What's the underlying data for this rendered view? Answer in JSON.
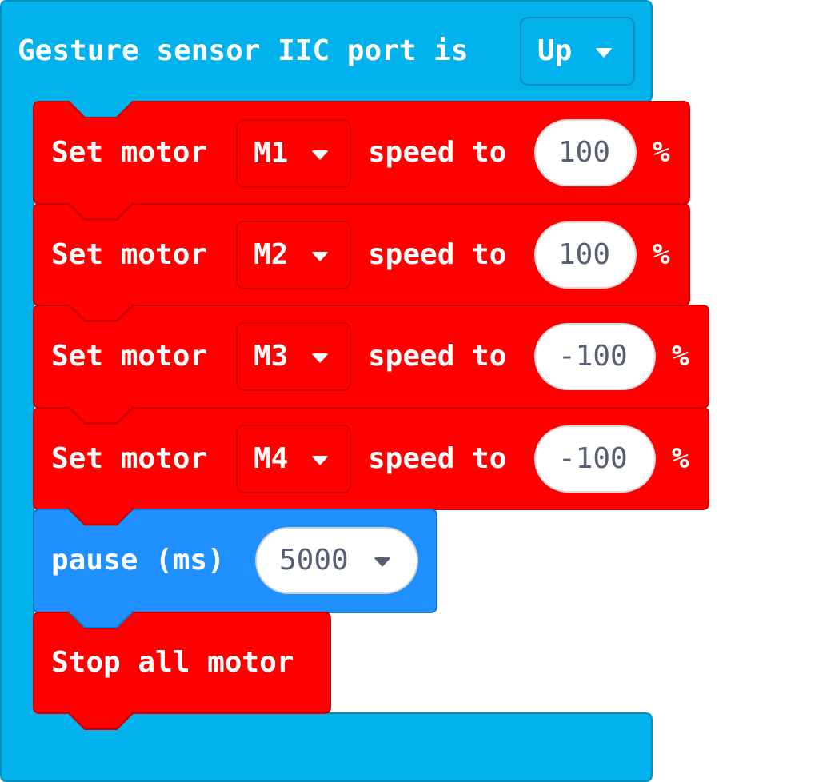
{
  "colors": {
    "gesture_block": "#02b2ec",
    "gesture_border": "#028fbd",
    "motor_block": "#ff0000",
    "motor_border": "#cc0000",
    "pause_block": "#1e90ff",
    "pause_border": "#1a73cc",
    "text": "#ffffff",
    "value_text": "#575e75"
  },
  "gesture_block": {
    "label": "Gesture sensor IIC port is",
    "direction_value": "Up",
    "dropdown_icon": "chevron-down-icon"
  },
  "motor_blocks": [
    {
      "label": "Set motor",
      "motor": "M1",
      "speed_label": "speed to",
      "speed": "100",
      "unit": "%"
    },
    {
      "label": "Set motor",
      "motor": "M2",
      "speed_label": "speed to",
      "speed": "100",
      "unit": "%"
    },
    {
      "label": "Set motor",
      "motor": "M3",
      "speed_label": "speed to",
      "speed": "-100",
      "unit": "%"
    },
    {
      "label": "Set motor",
      "motor": "M4",
      "speed_label": "speed to",
      "speed": "-100",
      "unit": "%"
    }
  ],
  "pause_block": {
    "label": "pause (ms)",
    "value": "5000"
  },
  "stop_block": {
    "label": "Stop all motor"
  }
}
